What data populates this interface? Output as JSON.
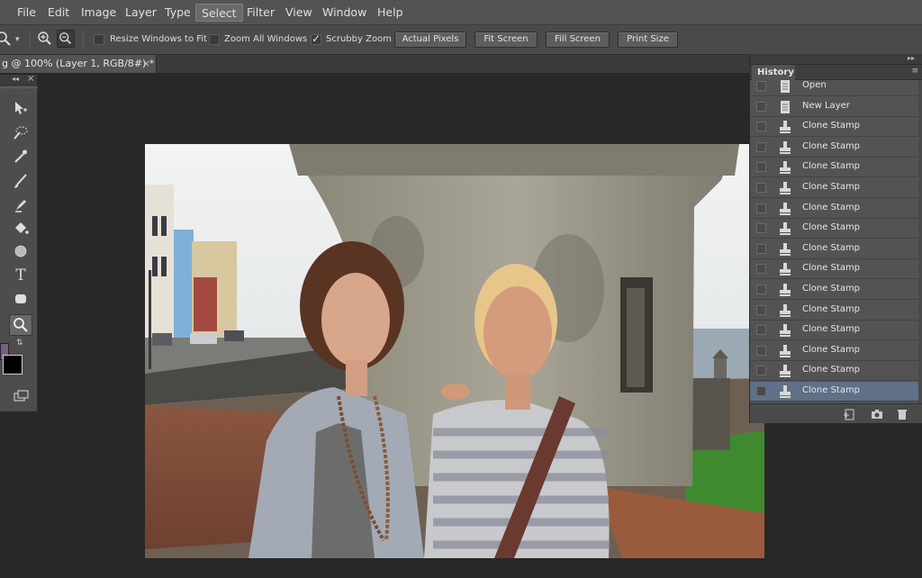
{
  "menu": {
    "items": [
      "File",
      "Edit",
      "Image",
      "Layer",
      "Type",
      "Select",
      "Filter",
      "View",
      "Window",
      "Help"
    ],
    "active": "Select"
  },
  "options_bar": {
    "checkboxes": [
      {
        "label": "Resize Windows to Fit",
        "checked": false
      },
      {
        "label": "Zoom All Windows",
        "checked": false
      },
      {
        "label": "Scrubby Zoom",
        "checked": true
      }
    ],
    "buttons": [
      "Actual Pixels",
      "Fit Screen",
      "Fill Screen",
      "Print Size"
    ]
  },
  "document_tab": {
    "title": "g @ 100% (Layer 1, RGB/8#) *",
    "close": "×"
  },
  "toolbox": {
    "collapse": "◂◂",
    "close": "×",
    "tools": [
      "move-tool-icon",
      "quick-selection-icon",
      "eyedropper-icon",
      "brush-icon",
      "clone-stamp-icon",
      "paint-bucket-icon",
      "burn-tool-icon",
      "type-tool-icon",
      "shape-tool-icon",
      "zoom-tool-icon",
      "swap-colors-icon",
      "screen-mode-icon"
    ],
    "type_tool_glyph": "T",
    "foreground_color": "#7a5d82",
    "background_color": "#000000"
  },
  "history": {
    "collapse": "▸▸",
    "title": "History",
    "items": [
      {
        "label": "Open",
        "icon": "document-icon"
      },
      {
        "label": "New Layer",
        "icon": "document-icon"
      },
      {
        "label": "Clone Stamp",
        "icon": "stamp-icon"
      },
      {
        "label": "Clone Stamp",
        "icon": "stamp-icon"
      },
      {
        "label": "Clone Stamp",
        "icon": "stamp-icon"
      },
      {
        "label": "Clone Stamp",
        "icon": "stamp-icon"
      },
      {
        "label": "Clone Stamp",
        "icon": "stamp-icon"
      },
      {
        "label": "Clone Stamp",
        "icon": "stamp-icon"
      },
      {
        "label": "Clone Stamp",
        "icon": "stamp-icon"
      },
      {
        "label": "Clone Stamp",
        "icon": "stamp-icon"
      },
      {
        "label": "Clone Stamp",
        "icon": "stamp-icon"
      },
      {
        "label": "Clone Stamp",
        "icon": "stamp-icon"
      },
      {
        "label": "Clone Stamp",
        "icon": "stamp-icon"
      },
      {
        "label": "Clone Stamp",
        "icon": "stamp-icon"
      },
      {
        "label": "Clone Stamp",
        "icon": "stamp-icon"
      },
      {
        "label": "Clone Stamp",
        "icon": "stamp-icon"
      }
    ],
    "selected_index": 15,
    "footer_icons": [
      "new-document-from-state-icon",
      "camera-icon",
      "trash-icon"
    ]
  },
  "colors": {
    "menu_bg": "#535353",
    "selection": "#5f7087"
  }
}
